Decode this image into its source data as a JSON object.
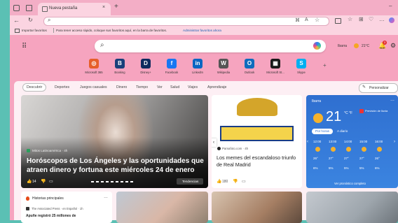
{
  "tab": {
    "title": "Nueva pestaña"
  },
  "omnibox": {
    "value": ""
  },
  "favorites": {
    "import_label": "Importar favoritos",
    "hint": "Para tener acceso rápido, coloque sus favoritos aquí, en la barra de favoritos.",
    "manage_link": "Administrar favoritos ahora"
  },
  "header": {
    "location": "Ibarra",
    "temp": "21°C",
    "notifications": "3"
  },
  "quicklinks": [
    {
      "label": "Microsoft 365",
      "glyph": "◎",
      "color": "#e65f2b"
    },
    {
      "label": "Booking",
      "glyph": "B",
      "color": "#19407a"
    },
    {
      "label": "Disney+",
      "glyph": "D",
      "color": "#0e2a5e"
    },
    {
      "label": "Facebook",
      "glyph": "f",
      "color": "#1877f2"
    },
    {
      "label": "LinkedIn",
      "glyph": "in",
      "color": "#0a66c2"
    },
    {
      "label": "Wikipedia",
      "glyph": "W",
      "color": "#555555"
    },
    {
      "label": "Outlook",
      "glyph": "O",
      "color": "#0f6cbd"
    },
    {
      "label": "Microsoft St...",
      "glyph": "▦",
      "color": "#1a1a1a"
    },
    {
      "label": "Skype",
      "glyph": "S",
      "color": "#00aff0"
    }
  ],
  "add_label": "+",
  "feed_tabs": [
    "Descubrir",
    "Deportes",
    "Juegos casuales",
    "Dinero",
    "Tiempo",
    "Ver",
    "Salud",
    "Viajes",
    "Aprendizaje"
  ],
  "personalize": "Personalizar",
  "hero": {
    "source": "Mitos Latinoamérica · 4h",
    "title": "Horóscopos de Los Ángeles y las oportunidades que atraen dinero y fortuna este miércoles 24 de enero",
    "likes": "14",
    "trending": "Tendencias"
  },
  "story2": {
    "source": "Pamafoto.com · 4h",
    "title": "Los memes del escandaloso triunfo de Real Madrid",
    "likes": "180"
  },
  "weather": {
    "city": "Ibarra",
    "temp": "21",
    "units": "°C °F",
    "tabs": [
      "Por horas",
      "A diario"
    ],
    "alert": "Previsión de lluvia",
    "hours": [
      "12:00",
      "13:00",
      "14:00",
      "15:00",
      "16:00"
    ],
    "temps": [
      "26°",
      "27°",
      "27°",
      "27°",
      "26°"
    ],
    "rain": [
      "6%",
      "5%",
      "5%",
      "5%",
      "6%"
    ],
    "footer": "Ver pronóstico completo"
  },
  "bottom": {
    "section": "Historias principales",
    "source": "The Associated Press · en Español · 1h",
    "headline": "Apuñe regístró 25 millones de"
  }
}
